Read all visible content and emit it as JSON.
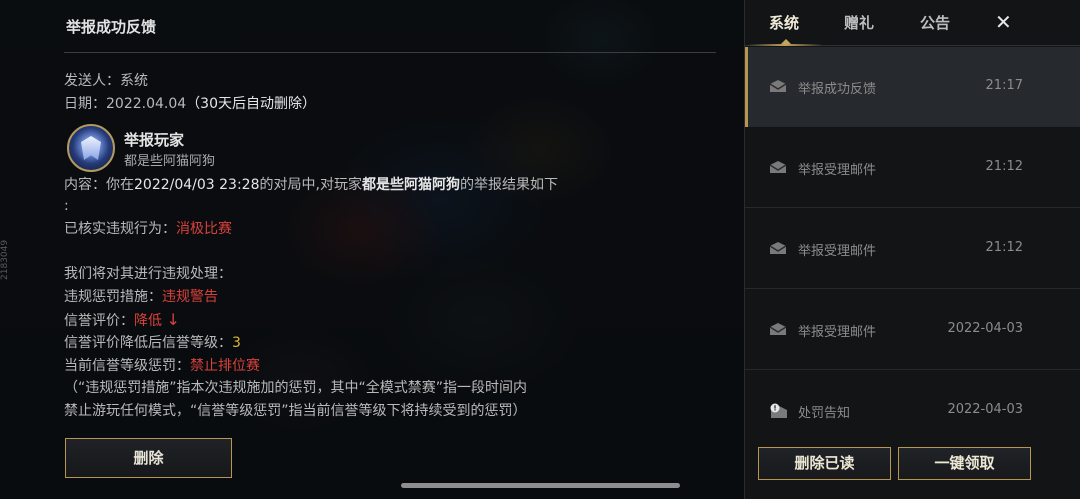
{
  "side_id": "2183049",
  "detail": {
    "title": "举报成功反馈",
    "sender_label": "发送人：",
    "sender_value": "系统",
    "date_label": "日期：",
    "date_value": "2022.04.04",
    "date_note": "（30天后自动删除）",
    "reported_title": "举报玩家",
    "reported_name": "都是些阿猫阿狗",
    "content_a": "内容：你在",
    "content_time": "2022/04/03 23:28",
    "content_b": "的对局中,对玩家",
    "content_player": "都是些阿猫阿狗",
    "content_c": "的举报结果如下",
    "content_colon": ":",
    "verified_label": "已核实违规行为：",
    "verified_value": "消极比赛",
    "handling_intro": "我们将对其进行违规处理：",
    "penalty_label": "违规惩罚措施：",
    "penalty_value": "违规警告",
    "credit_label": "信誉评价：",
    "credit_value": "降低",
    "credit_arrow": "↓",
    "credit_level_label": "信誉评价降低后信誉等级：",
    "credit_level_value": "3",
    "current_penalty_label": "当前信誉等级惩罚：",
    "current_penalty_value": "禁止排位赛",
    "note_line1": "（“违规惩罚措施”指本次违规施加的惩罚，其中“全模式禁赛”指一段时间内",
    "note_line2": "禁止游玩任何模式，“信誉等级惩罚”指当前信誉等级下将持续受到的惩罚）",
    "delete_label": "删除"
  },
  "panel": {
    "tabs": [
      {
        "label": "系统",
        "active": true
      },
      {
        "label": "赠礼",
        "active": false
      },
      {
        "label": "公告",
        "active": false
      }
    ],
    "close_label": "✕",
    "mails": [
      {
        "subject": "举报成功反馈",
        "time": "21:17",
        "icon": "mail-open-icon",
        "selected": true
      },
      {
        "subject": "举报受理邮件",
        "time": "21:12",
        "icon": "mail-open-icon",
        "selected": false
      },
      {
        "subject": "举报受理邮件",
        "time": "21:12",
        "icon": "mail-open-icon",
        "selected": false
      },
      {
        "subject": "举报受理邮件",
        "time": "2022-04-03",
        "icon": "mail-open-icon",
        "selected": false
      },
      {
        "subject": "处罚告知",
        "time": "2022-04-03",
        "icon": "mail-alert-icon",
        "selected": false
      }
    ],
    "delete_read_label": "删除已读",
    "claim_all_label": "一键领取"
  },
  "colors": {
    "accent_gold": "#b8964f",
    "warning_red": "#d8413b",
    "level_gold": "#e1b33d"
  }
}
